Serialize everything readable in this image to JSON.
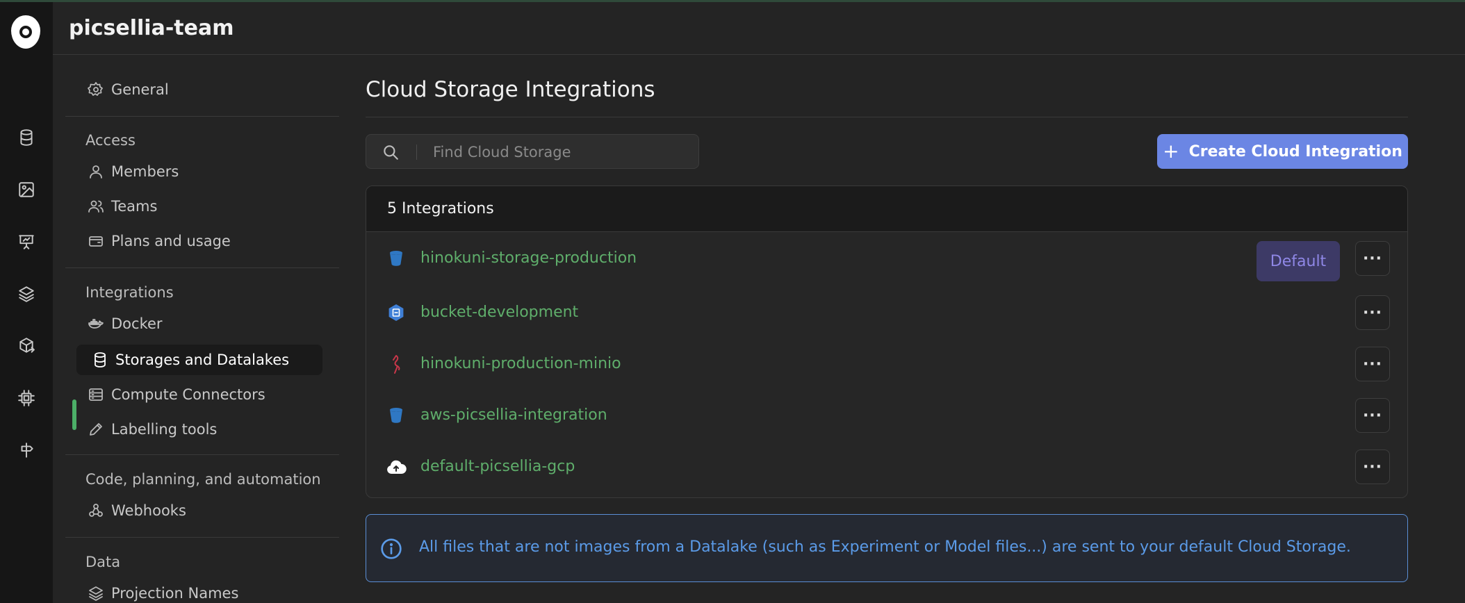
{
  "app": {
    "org_name": "picsellia-team"
  },
  "rail": {
    "icons": [
      "logo-icon",
      "database-icon",
      "image-icon",
      "presentation-icon",
      "layers-icon",
      "package-export-icon",
      "chip-icon",
      "signpost-icon"
    ]
  },
  "sidebar": {
    "general": "General",
    "sections": {
      "access": "Access",
      "integrations": "Integrations",
      "code": "Code, planning, and automation",
      "data": "Data"
    },
    "items": {
      "members": "Members",
      "teams": "Teams",
      "plans": "Plans and usage",
      "docker": "Docker",
      "storages": "Storages and Datalakes",
      "compute": "Compute Connectors",
      "labelling": "Labelling tools",
      "webhooks": "Webhooks",
      "projection": "Projection Names"
    },
    "active_item": "storages"
  },
  "main": {
    "title": "Cloud Storage Integrations",
    "search_placeholder": "Find Cloud Storage",
    "search_value": "",
    "create_button": "Create Cloud Integration",
    "count_label": "5 Integrations",
    "integrations": [
      {
        "name": "hinokuni-storage-production",
        "icon": "aws-s3-bucket-icon",
        "default": true
      },
      {
        "name": "bucket-development",
        "icon": "gcp-storage-icon",
        "default": false
      },
      {
        "name": "hinokuni-production-minio",
        "icon": "minio-icon",
        "default": false
      },
      {
        "name": "aws-picsellia-integration",
        "icon": "aws-s3-bucket-icon",
        "default": false
      },
      {
        "name": "default-picsellia-gcp",
        "icon": "cloud-upload-icon",
        "default": false
      }
    ],
    "default_badge": "Default",
    "more_label": "···",
    "info_text": "All files that are not images from a Datalake (such as Experiment or Model files...) are sent to your default Cloud Storage."
  },
  "colors": {
    "accent_primary": "#6b86e4",
    "link_green": "#5fae6b",
    "active_indicator": "#4caf68",
    "badge_bg": "#3d3a66",
    "badge_text": "#8f87e6",
    "info_blue": "#5b9be8"
  }
}
